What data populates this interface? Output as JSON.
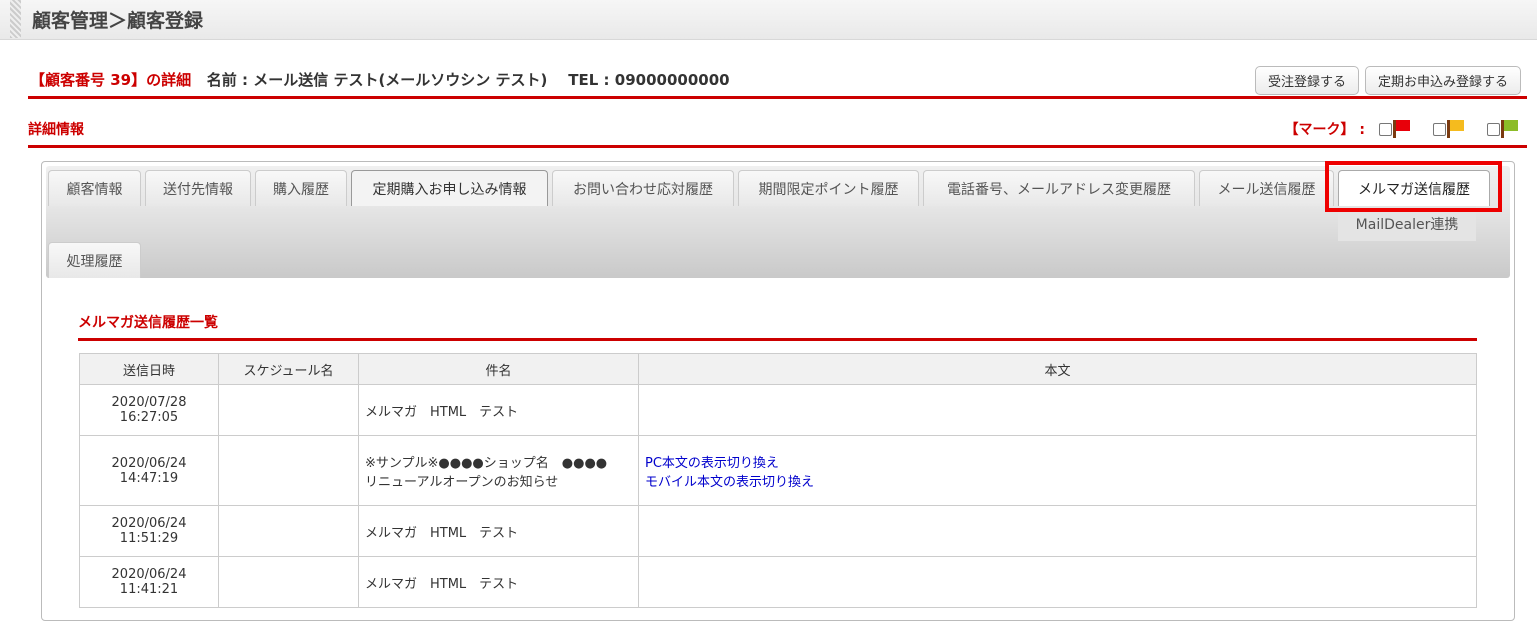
{
  "header": {
    "title": "顧客管理＞顧客登録"
  },
  "customer": {
    "number_label": "【顧客番号 39】の詳細",
    "name_label": "名前 : メール送信 テスト(メールソウシン テスト)",
    "tel_label": "TEL : 09000000000"
  },
  "buttons": {
    "order": "受注登録する",
    "subscription": "定期お申込み登録する"
  },
  "details": {
    "title": "詳細情報",
    "mark_label": "【マーク】 :"
  },
  "flags": [
    {
      "color": "#e8000a"
    },
    {
      "color": "#f5bb1e"
    },
    {
      "color": "#8cbc28"
    }
  ],
  "tabs": [
    "顧客情報",
    "送付先情報",
    "購入履歴",
    "定期購入お申し込み情報",
    "お問い合わせ応対履歴",
    "期間限定ポイント履歴",
    "電話番号、メールアドレス変更履歴",
    "メール送信履歴",
    "メルマガ送信履歴",
    "MailDealer連携",
    "処理履歴"
  ],
  "list": {
    "title": "メルマガ送信履歴一覧",
    "columns": [
      "送信日時",
      "スケジュール名",
      "件名",
      "本文"
    ],
    "rows": [
      {
        "date": "2020/07/28",
        "time": "16:27:05",
        "schedule": "",
        "subject": "メルマガ　HTML　テスト",
        "links": []
      },
      {
        "date": "2020/06/24",
        "time": "14:47:19",
        "schedule": "",
        "subject": "※サンプル※●●●●ショップ名　●●●●　リニューアルオープンのお知らせ",
        "links": [
          "PC本文の表示切り換え",
          "モバイル本文の表示切り換え"
        ]
      },
      {
        "date": "2020/06/24",
        "time": "11:51:29",
        "schedule": "",
        "subject": "メルマガ　HTML　テスト",
        "links": []
      },
      {
        "date": "2020/06/24",
        "time": "11:41:21",
        "schedule": "",
        "subject": "メルマガ　HTML　テスト",
        "links": []
      }
    ]
  }
}
